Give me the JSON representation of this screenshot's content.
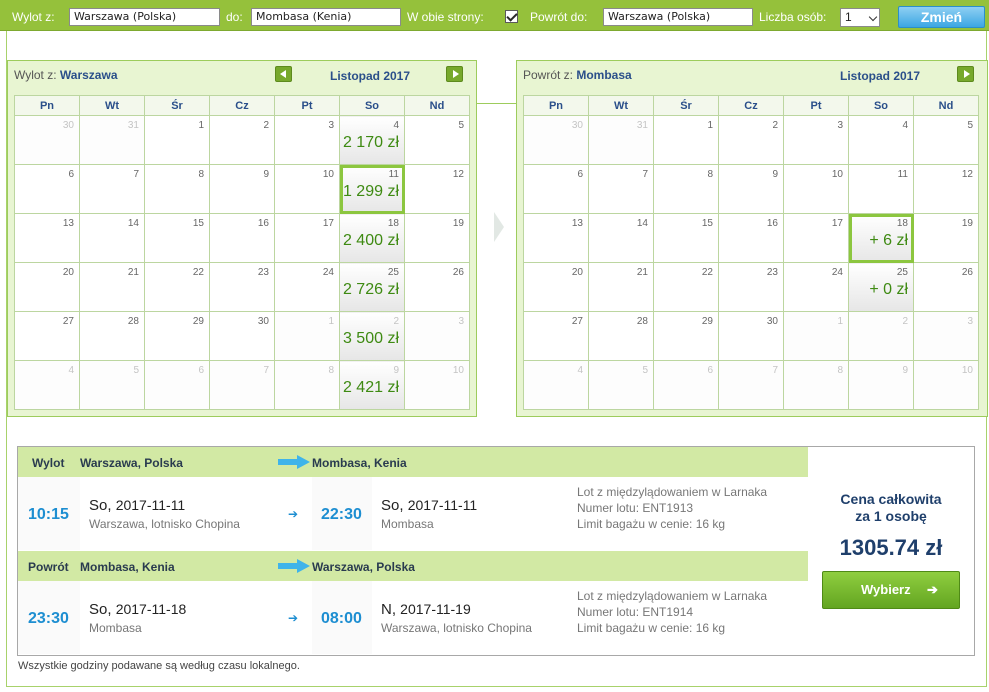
{
  "search": {
    "from_label": "Wylot z:",
    "from_value": "Warszawa (Polska)",
    "to_label": "do:",
    "to_value": "Mombasa (Kenia)",
    "roundtrip_label": "W obie strony:",
    "roundtrip_checked": true,
    "return_label": "Powrót do:",
    "return_value": "Warszawa (Polska)",
    "persons_label": "Liczba osób:",
    "persons_value": "1",
    "change_label": "Zmień"
  },
  "colors": {
    "accent_green": "#95c13b",
    "price_green": "#3e8a12",
    "time_blue": "#1d8ed1",
    "navy": "#1f3f6b"
  },
  "calendar_out": {
    "title_prefix": "Wylot z:",
    "city": "Warszawa",
    "month": "Listopad 2017",
    "weekdays": [
      "Pn",
      "Wt",
      "Śr",
      "Cz",
      "Pt",
      "So",
      "Nd"
    ],
    "weeks": [
      [
        {
          "d": "30",
          "o": true
        },
        {
          "d": "31",
          "o": true
        },
        {
          "d": "1"
        },
        {
          "d": "2"
        },
        {
          "d": "3"
        },
        {
          "d": "4",
          "p": "2 170 zł"
        },
        {
          "d": "5"
        }
      ],
      [
        {
          "d": "6"
        },
        {
          "d": "7"
        },
        {
          "d": "8"
        },
        {
          "d": "9"
        },
        {
          "d": "10"
        },
        {
          "d": "11",
          "p": "1 299 zł",
          "sel": true
        },
        {
          "d": "12"
        }
      ],
      [
        {
          "d": "13"
        },
        {
          "d": "14"
        },
        {
          "d": "15"
        },
        {
          "d": "16"
        },
        {
          "d": "17"
        },
        {
          "d": "18",
          "p": "2 400 zł"
        },
        {
          "d": "19"
        }
      ],
      [
        {
          "d": "20"
        },
        {
          "d": "21"
        },
        {
          "d": "22"
        },
        {
          "d": "23"
        },
        {
          "d": "24"
        },
        {
          "d": "25",
          "p": "2 726 zł"
        },
        {
          "d": "26"
        }
      ],
      [
        {
          "d": "27"
        },
        {
          "d": "28"
        },
        {
          "d": "29"
        },
        {
          "d": "30"
        },
        {
          "d": "1",
          "o": true
        },
        {
          "d": "2",
          "o": true,
          "p": "3 500 zł"
        },
        {
          "d": "3",
          "o": true
        }
      ],
      [
        {
          "d": "4",
          "o": true
        },
        {
          "d": "5",
          "o": true
        },
        {
          "d": "6",
          "o": true
        },
        {
          "d": "7",
          "o": true
        },
        {
          "d": "8",
          "o": true
        },
        {
          "d": "9",
          "o": true,
          "p": "2 421 zł"
        },
        {
          "d": "10",
          "o": true
        }
      ]
    ]
  },
  "calendar_ret": {
    "title_prefix": "Powrót z:",
    "city": "Mombasa",
    "month": "Listopad 2017",
    "weekdays": [
      "Pn",
      "Wt",
      "Śr",
      "Cz",
      "Pt",
      "So",
      "Nd"
    ],
    "weeks": [
      [
        {
          "d": "30",
          "o": true
        },
        {
          "d": "31",
          "o": true
        },
        {
          "d": "1"
        },
        {
          "d": "2"
        },
        {
          "d": "3"
        },
        {
          "d": "4"
        },
        {
          "d": "5"
        }
      ],
      [
        {
          "d": "6"
        },
        {
          "d": "7"
        },
        {
          "d": "8"
        },
        {
          "d": "9"
        },
        {
          "d": "10"
        },
        {
          "d": "11"
        },
        {
          "d": "12"
        }
      ],
      [
        {
          "d": "13"
        },
        {
          "d": "14"
        },
        {
          "d": "15"
        },
        {
          "d": "16"
        },
        {
          "d": "17"
        },
        {
          "d": "18",
          "p": "+ 6 zł",
          "sel": true
        },
        {
          "d": "19"
        }
      ],
      [
        {
          "d": "20"
        },
        {
          "d": "21"
        },
        {
          "d": "22"
        },
        {
          "d": "23"
        },
        {
          "d": "24"
        },
        {
          "d": "25",
          "p": "+ 0 zł"
        },
        {
          "d": "26"
        }
      ],
      [
        {
          "d": "27"
        },
        {
          "d": "28"
        },
        {
          "d": "29"
        },
        {
          "d": "30"
        },
        {
          "d": "1",
          "o": true
        },
        {
          "d": "2",
          "o": true
        },
        {
          "d": "3",
          "o": true
        }
      ],
      [
        {
          "d": "4",
          "o": true
        },
        {
          "d": "5",
          "o": true
        },
        {
          "d": "6",
          "o": true
        },
        {
          "d": "7",
          "o": true
        },
        {
          "d": "8",
          "o": true
        },
        {
          "d": "9",
          "o": true
        },
        {
          "d": "10",
          "o": true
        }
      ]
    ]
  },
  "outbound": {
    "label": "Wylot",
    "from": "Warszawa, Polska",
    "to": "Mombasa, Kenia",
    "dep_time": "10:15",
    "dep_day": "So,",
    "dep_date": "2017-11-11",
    "dep_place": "Warszawa, lotnisko Chopina",
    "arr_time": "22:30",
    "arr_day": "So,",
    "arr_date": "2017-11-11",
    "arr_place": "Mombasa",
    "info1": "Lot z międzylądowaniem w Larnaka",
    "info2": "Numer lotu: ENT1913",
    "info3": "Limit bagażu w cenie: 16 kg"
  },
  "return": {
    "label": "Powrót",
    "from": "Mombasa, Kenia",
    "to": "Warszawa, Polska",
    "dep_time": "23:30",
    "dep_day": "So,",
    "dep_date": "2017-11-18",
    "dep_place": "Mombasa",
    "arr_time": "08:00",
    "arr_day": "N,",
    "arr_date": "2017-11-19",
    "arr_place": "Warszawa, lotnisko Chopina",
    "info1": "Lot z międzylądowaniem w Larnaka",
    "info2": "Numer lotu: ENT1914",
    "info3": "Limit bagażu w cenie: 16 kg"
  },
  "total": {
    "label_line1": "Cena całkowita",
    "label_line2": "za 1 osobę",
    "value": "1305.74 zł",
    "choose_label": "Wybierz"
  },
  "footnote": "Wszystkie godziny podawane są według czasu lokalnego."
}
